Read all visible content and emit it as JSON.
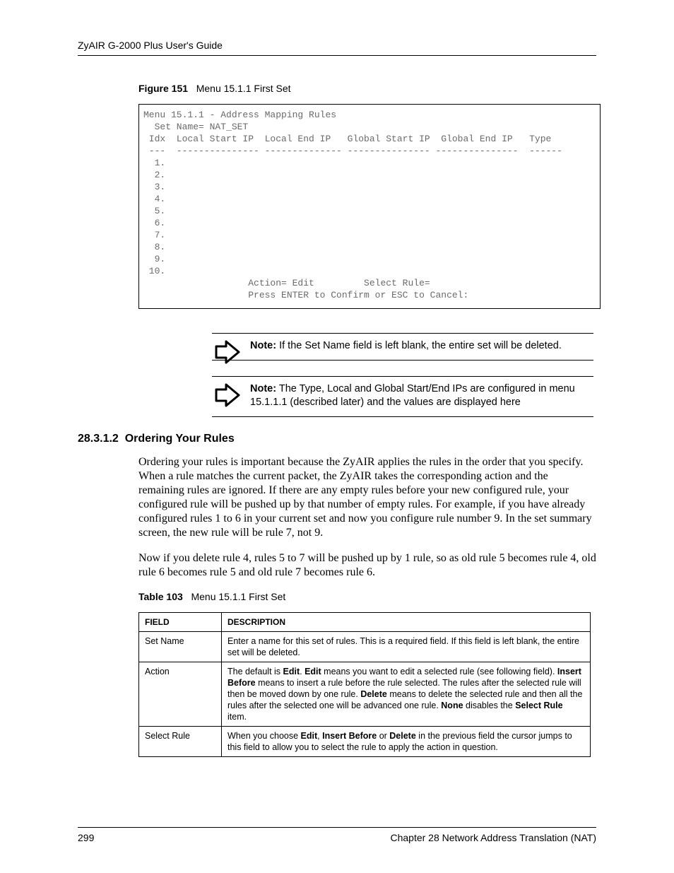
{
  "header": {
    "text": "ZyAIR G-2000 Plus User's Guide"
  },
  "figure": {
    "label": "Figure 151",
    "caption": "Menu 15.1.1 First Set"
  },
  "terminal": {
    "title": "Menu 15.1.1 - Address Mapping Rules",
    "setname_line": "  Set Name= NAT_SET",
    "header_row": " Idx  Local Start IP  Local End IP   Global Start IP  Global End IP   Type",
    "sep_row": " ---  --------------- -------------- --------------- ---------------  ------",
    "rows": [
      "  1.",
      "  2.",
      "  3.",
      "  4.",
      "  5.",
      "  6.",
      "  7.",
      "  8.",
      "  9.",
      " 10."
    ],
    "action_line": "                   Action= Edit         Select Rule=",
    "press_line": "                   Press ENTER to Confirm or ESC to Cancel:"
  },
  "notes": {
    "label": "Note:",
    "n1": "If the Set Name field is left blank, the entire set will be deleted.",
    "n2": "The Type, Local and Global Start/End IPs are configured in menu 15.1.1.1 (described later) and the values are displayed here"
  },
  "section": {
    "num": "28.3.1.2",
    "title": "Ordering Your Rules",
    "p1": "Ordering your rules is important because the ZyAIR applies the rules in the order that you specify. When a rule matches the current packet, the ZyAIR takes the corresponding action and the remaining rules are ignored. If there are any empty rules before your new configured rule, your configured rule will be pushed up by that number of empty rules. For example, if you have already configured rules 1 to 6 in your current set and now you configure rule number 9. In the set summary screen, the new rule will be rule 7, not 9.",
    "p2": "Now if you delete rule 4, rules 5 to 7 will be pushed up by 1 rule, so as old rule 5 becomes rule 4, old rule 6 becomes rule 5 and old rule 7 becomes rule 6."
  },
  "table": {
    "label": "Table 103",
    "caption": "Menu 15.1.1 First Set",
    "head": {
      "c1": "FIELD",
      "c2": "DESCRIPTION"
    },
    "rows": [
      {
        "field": "Set Name",
        "desc_html": "Enter a name for this set of rules. This is a required field. If this field is left blank, the entire set will be deleted."
      },
      {
        "field": "Action",
        "desc_html": "The default is <b>Edit</b>. <b>Edit</b> means you want to edit a selected rule (see following field). <b>Insert Before</b> means to insert a rule before the rule selected. The rules after the selected rule will then be moved down by one rule. <b>Delete</b> means to delete the selected rule and then all the rules after the selected one will be advanced one rule. <b>None</b> disables the <b>Select Rule</b> item."
      },
      {
        "field": "Select Rule",
        "desc_html": "When you choose <b>Edit</b>, <b>Insert Before</b> or <b>Delete</b> in the previous field the cursor jumps to this field to allow you to select the rule to apply the action in question."
      }
    ]
  },
  "footer": {
    "page": "299",
    "chapter": "Chapter 28 Network Address Translation (NAT)"
  }
}
